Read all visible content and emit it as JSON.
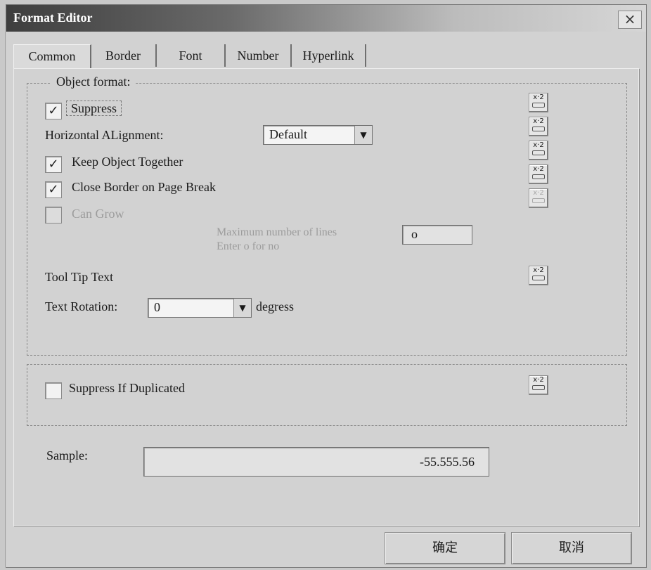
{
  "window": {
    "title": "Format Editor",
    "close_label": "×"
  },
  "tabs": [
    {
      "label": "Common"
    },
    {
      "label": "Border"
    },
    {
      "label": "Font"
    },
    {
      "label": "Number"
    },
    {
      "label": "Hyperlink"
    }
  ],
  "object_format": {
    "legend": "Object format:",
    "suppress_label": "Suppress",
    "halign_label": "Horizontal ALignment:",
    "halign_value": "Default",
    "keep_together_label": "Keep Object Together",
    "close_border_label": "Close Border on Page Break",
    "can_grow_label": "Can Grow",
    "max_lines_label": "Maximum number of lines",
    "max_lines_hint": "Enter o for no",
    "max_lines_value": "o",
    "tooltip_label": "Tool Tip Text",
    "rotation_label": "Text Rotation:",
    "rotation_value": "0",
    "rotation_unit": "degress"
  },
  "checks": {
    "suppress": "✓",
    "keep_together": "✓",
    "close_border": "✓",
    "can_grow": "",
    "suppress_dup": ""
  },
  "formula_button": {
    "label": "x·2"
  },
  "suppress_dup_label": "Suppress If Duplicated",
  "sample": {
    "label": "Sample:",
    "value": "-55.555.56"
  },
  "buttons": {
    "ok": "确定",
    "cancel": "取消"
  }
}
